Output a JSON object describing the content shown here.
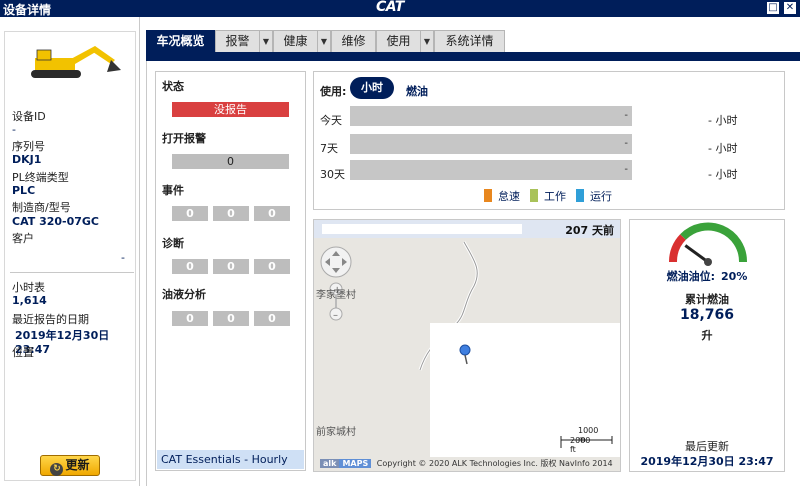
{
  "window": {
    "title": "设备详情",
    "logo": "CAT",
    "restore_glyph": "□",
    "close_glyph": "✕"
  },
  "left": {
    "equipment_id_label": "设备ID",
    "equipment_id_value": "-",
    "serial_label": "序列号",
    "serial_value": "DKJ1",
    "pl_label": "PL终端类型",
    "pl_value": "PLC",
    "make_label": "制造商/型号",
    "make_value": "CAT 320-07GC",
    "customer_label": "客户",
    "customer_value": "-",
    "hours_label": "小时表",
    "hours_value": "1,614",
    "last_report_label": "最近报告的日期",
    "last_report_value": "2019年12月30日 23:47",
    "location_label": "位置",
    "refresh_label": "更新"
  },
  "tabs": [
    {
      "label": "车况概览",
      "active": true
    },
    {
      "label": "报警",
      "dropdown": true
    },
    {
      "label": "健康",
      "dropdown": true
    },
    {
      "label": "维修"
    },
    {
      "label": "使用",
      "dropdown": true
    },
    {
      "label": "系统详情"
    }
  ],
  "status": {
    "state_label": "状态",
    "state_value": "没报告",
    "open_alerts_label": "打开报警",
    "open_alerts_value": "0",
    "events_label": "事件",
    "events_values": [
      "0",
      "0",
      "0"
    ],
    "diagnostics_label": "诊断",
    "diagnostics_values": [
      "0",
      "0",
      "0"
    ],
    "fluid_label": "油液分析",
    "fluid_values": [
      "0",
      "0",
      "0"
    ],
    "footer": "CAT Essentials - Hourly"
  },
  "usage": {
    "label": "使用:",
    "hours_toggle": "小时",
    "fuel_toggle": "燃油",
    "rows": [
      {
        "label": "今天",
        "value": "-",
        "hours": "- 小时"
      },
      {
        "label": "7天",
        "value": "-",
        "hours": "- 小时"
      },
      {
        "label": "30天",
        "value": "-",
        "hours": "- 小时"
      }
    ],
    "legend": [
      {
        "label": "怠速",
        "color": "#e8871e"
      },
      {
        "label": "工作",
        "color": "#a9c25a"
      },
      {
        "label": "运行",
        "color": "#2f9fd8"
      }
    ]
  },
  "map": {
    "days_ago": "207 天前",
    "village_1": "李家堡村",
    "village_2": "前家城村",
    "scale_m": "1000 m",
    "scale_ft": "2000 ft",
    "alk": "alk",
    "maps": "MAPS",
    "copyright": "Copyright © 2020 ALK Technologies Inc. 版权 NavInfo 2014"
  },
  "fuel": {
    "level_label": "燃油油位:",
    "level_value": "20%",
    "level_fraction": 0.2,
    "total_label": "累计燃油",
    "total_value": "18,766",
    "unit": "升",
    "last_update_label": "最后更新",
    "last_update_value": "2019年12月30日 23:47",
    "gauge_colors": {
      "red": "#d93030",
      "green": "#3aa23a"
    }
  }
}
